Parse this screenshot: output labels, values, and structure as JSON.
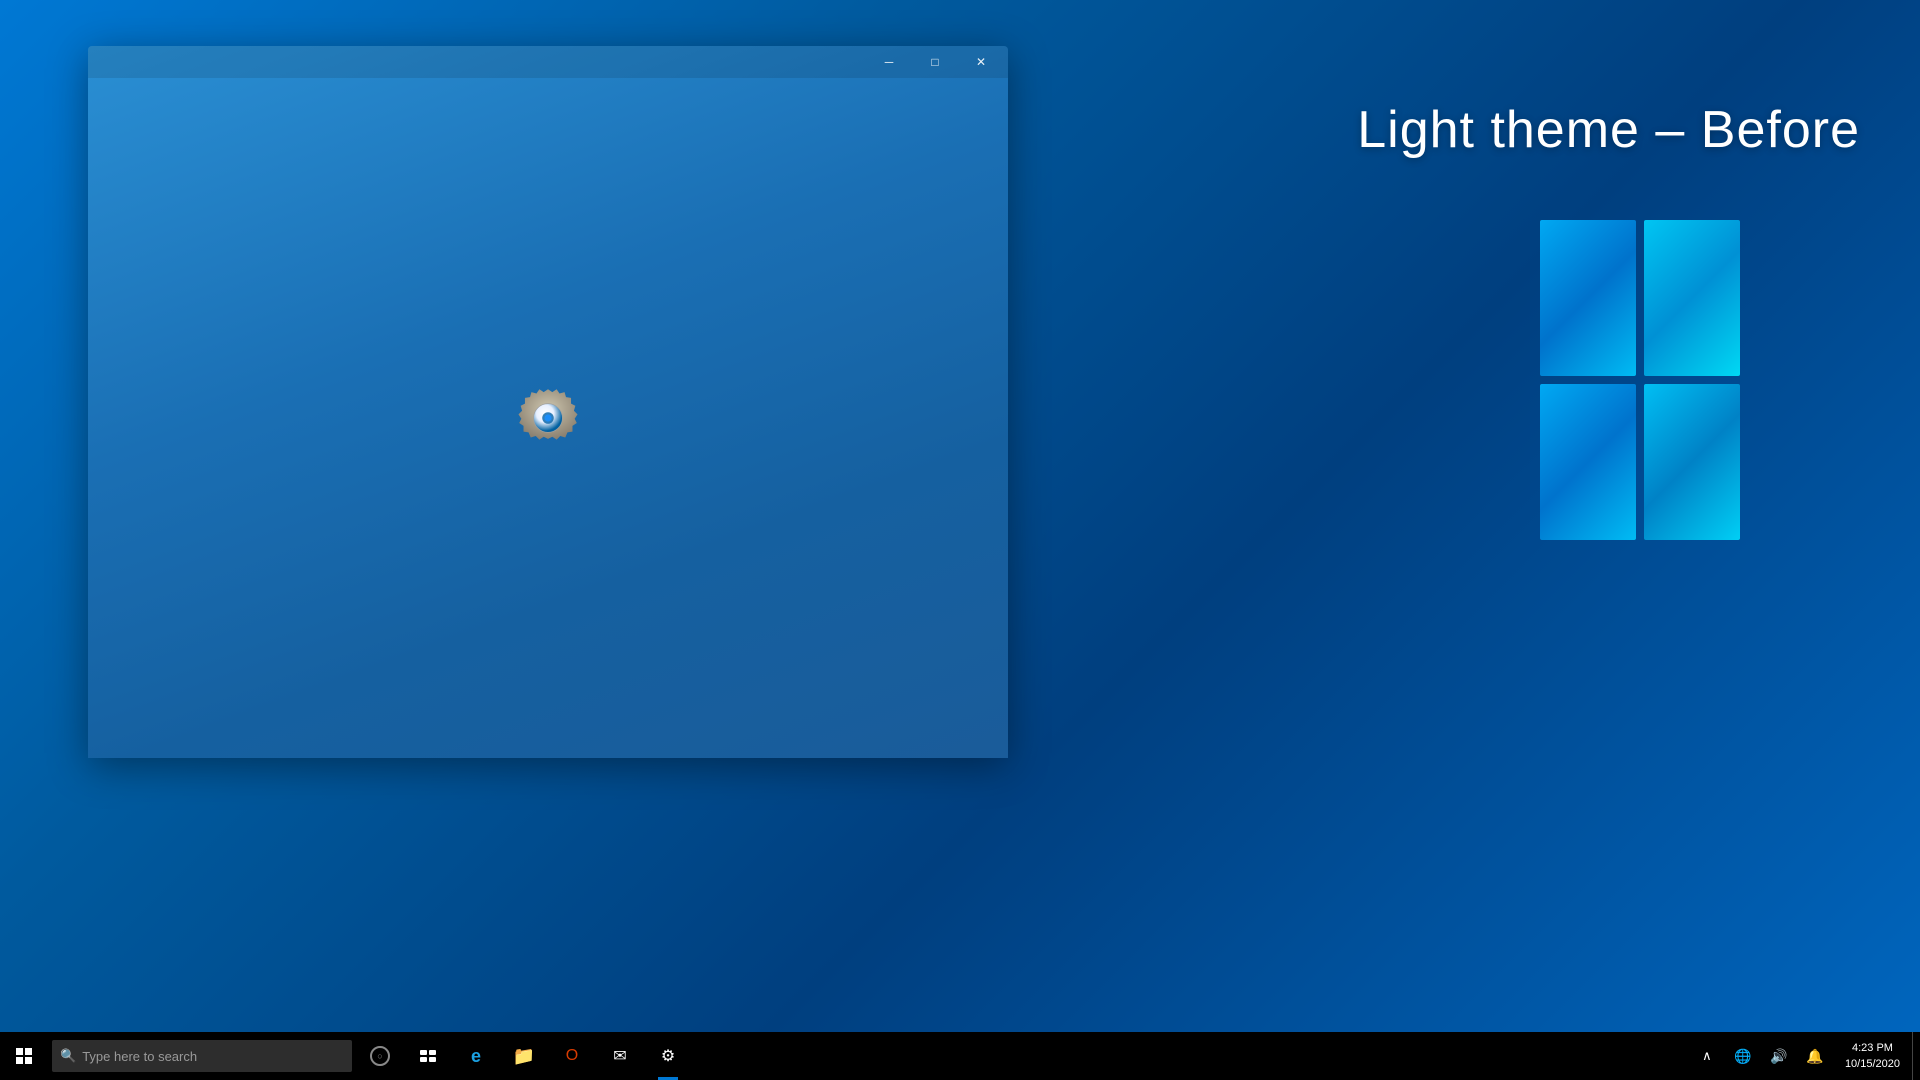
{
  "desktop": {
    "background_color": "#0078d4"
  },
  "label": {
    "text": "Light theme – Before"
  },
  "window": {
    "title": "Settings",
    "minimize_label": "─",
    "restore_label": "□",
    "close_label": "✕"
  },
  "taskbar": {
    "search_placeholder": "Type here to search",
    "icons": [
      {
        "name": "cortana",
        "label": "Cortana"
      },
      {
        "name": "task-view",
        "label": "Task View"
      },
      {
        "name": "edge",
        "label": "Microsoft Edge"
      },
      {
        "name": "file-explorer",
        "label": "File Explorer"
      },
      {
        "name": "office",
        "label": "Office"
      },
      {
        "name": "mail",
        "label": "Mail"
      },
      {
        "name": "settings",
        "label": "Settings"
      }
    ],
    "tray": {
      "show_hidden": "^",
      "network": "🌐",
      "volume": "🔊",
      "time": "4:23 PM",
      "date": "10/15/2020"
    }
  }
}
